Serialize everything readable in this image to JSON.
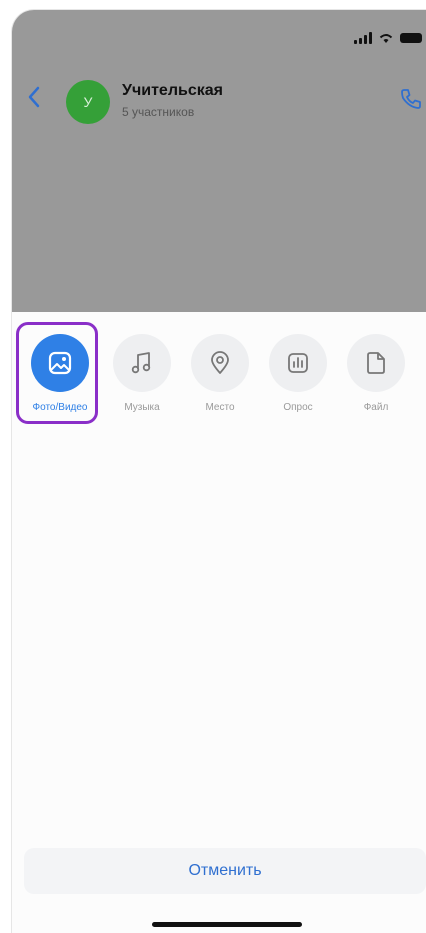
{
  "chat": {
    "avatar_letter": "У",
    "title": "Учительская",
    "subtitle": "5 участников"
  },
  "attachments": [
    {
      "label": "Фото/Видео",
      "icon": "image-icon",
      "active": true
    },
    {
      "label": "Музыка",
      "icon": "music-note-icon",
      "active": false
    },
    {
      "label": "Место",
      "icon": "location-pin-icon",
      "active": false
    },
    {
      "label": "Опрос",
      "icon": "poll-chart-icon",
      "active": false
    },
    {
      "label": "Файл",
      "icon": "file-icon",
      "active": false
    }
  ],
  "cancel_label": "Отменить",
  "colors": {
    "accent": "#2f80e6",
    "highlight": "#8a2fc8",
    "avatar": "#35a038",
    "dim_overlay": "#999999"
  }
}
